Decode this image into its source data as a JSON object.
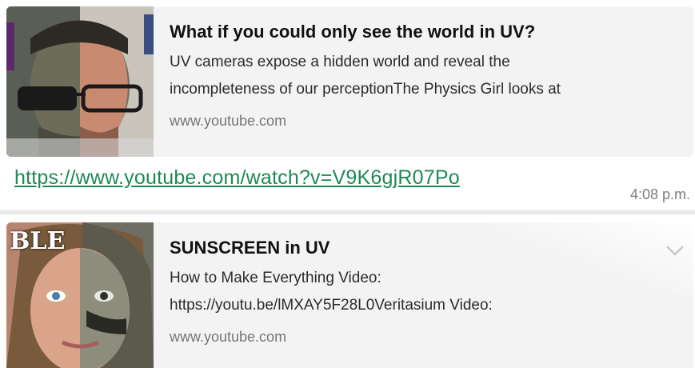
{
  "messages": [
    {
      "preview": {
        "title": "What if you could only see the world in UV?",
        "description_lines": [
          "UV cameras expose a hidden world and reveal the",
          "incompleteness of our perceptionThe Physics Girl looks at"
        ],
        "domain": "www.youtube.com",
        "thumbnail": "man-half-uv-face"
      },
      "link": "https://www.youtube.com/watch?v=V9K6gjR07Po",
      "time": "4:08 p.m."
    },
    {
      "preview": {
        "title": "SUNSCREEN in UV",
        "description_lines": [
          "How to Make Everything Video:",
          "https://youtu.be/lMXAY5F28L0Veritasium Video:"
        ],
        "domain": "www.youtube.com",
        "thumbnail": "woman-half-uv-face",
        "thumbnail_text": "BLE"
      },
      "menu_icon": "chevron-down-icon"
    }
  ],
  "colors": {
    "link": "#1d8a56",
    "preview_bg": "#f3f3f3",
    "timestamp": "#7d7d7d"
  }
}
